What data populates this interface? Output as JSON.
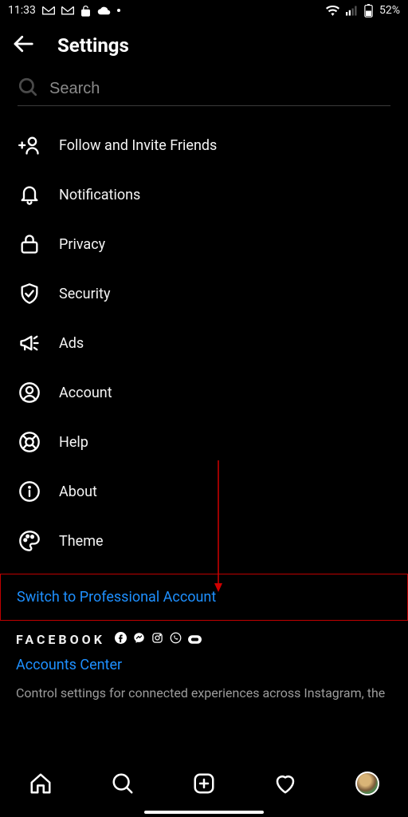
{
  "status": {
    "time": "11:33",
    "battery": "52%"
  },
  "header": {
    "title": "Settings"
  },
  "search": {
    "placeholder": "Search"
  },
  "menu": {
    "items": [
      {
        "label": "Follow and Invite Friends"
      },
      {
        "label": "Notifications"
      },
      {
        "label": "Privacy"
      },
      {
        "label": "Security"
      },
      {
        "label": "Ads"
      },
      {
        "label": "Account"
      },
      {
        "label": "Help"
      },
      {
        "label": "About"
      },
      {
        "label": "Theme"
      }
    ]
  },
  "switch_link": "Switch to Professional Account",
  "fb": {
    "brand": "FACEBOOK",
    "accounts_center": "Accounts Center",
    "desc": "Control settings for connected experiences across Instagram, the"
  }
}
